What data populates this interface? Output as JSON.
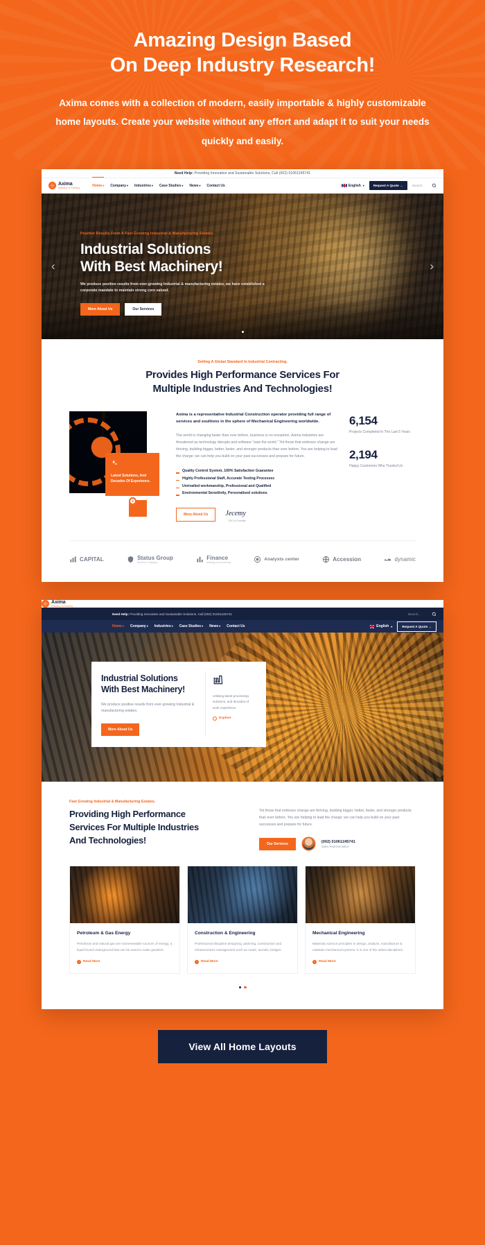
{
  "promo": {
    "title_line1": "Amazing Design Based",
    "title_line2": "On Deep Industry Research!",
    "subtitle": "Axima comes with a collection of modern, easily importable & highly customizable home layouts. Create your website without any effort and adapt it to suit your needs quickly and easily."
  },
  "colors": {
    "brand_orange": "#F4661B",
    "brand_navy": "#16213E",
    "nav2_bar": "#1E2C52",
    "muted_text": "#7B8494"
  },
  "site1": {
    "topbar": {
      "label": "Need Help:",
      "text": " Providing Innovative and Sustainable Solutions, Call (002) 01061245741"
    },
    "logo": {
      "name": "Axima",
      "tagline": "Industry & Factory"
    },
    "menu": [
      {
        "label": "Home",
        "caret": "▾",
        "active": true
      },
      {
        "label": "Company",
        "caret": "▾",
        "active": false
      },
      {
        "label": "Industries",
        "caret": "▾",
        "active": false
      },
      {
        "label": "Case Studies",
        "caret": "▾",
        "active": false
      },
      {
        "label": "News",
        "caret": "▾",
        "active": false
      },
      {
        "label": "Contact Us",
        "caret": "",
        "active": false
      }
    ],
    "lang": {
      "label": "English",
      "caret": "▾"
    },
    "quote_button": "Request A Quote →",
    "search_placeholder": "Search...",
    "hero": {
      "eyebrow": "Positive Results From A Fast Growing Industrial & Manufacturing Estates.",
      "title_line1": "Industrial Solutions",
      "title_line2": "With Best Machinery!",
      "desc": "We produce positive results from ever-growing Industrial & manufacturing estates, we have established a corporate mandate to maintain strong core valued.",
      "btn_primary": "More About Us",
      "btn_secondary": "Our Services",
      "arrow_left": "‹",
      "arrow_right": "›"
    },
    "section": {
      "eyebrow": "Setting A Global Standard In Industrial Contracting.",
      "title_line1": "Provides High Performance Services For",
      "title_line2": "Multiple Industries And Technologies!",
      "visual_box_text": "Latest Solutions, And Decades Of Experience.",
      "plus": "+",
      "lead": "Axima is a representative Industrial Construction operator providing full range of services and soultions in the sphere of Mechanical Engineering worldwide.",
      "body": "The world is changing faster than ever before, business is no exception. Axima industries are threatened as technology disrupts and software “eats the world.” Yet those that embrace change are thriving, building bigger, better, faster, and stronger products than ever before. You are helping to lead the charge; we can help you build on your past successes and prepare for future.",
      "features": [
        "Quality Control System, 100% Satisfaction Guarantee",
        "Highly Professional Staff, Accurate Testing Processes",
        "Unrivalled workmanship, Professional and Qualified",
        "Environmental Sensitivity, Personalised solutions"
      ],
      "btn": "More About Us",
      "signature": "Jecemy",
      "signature_role": "CEO & Founder",
      "stats": [
        {
          "number": "6,154",
          "label": "Projects Completed In The Last 5 Years"
        },
        {
          "number": "2,194",
          "label": "Happy Customers Who Trusted Us"
        }
      ],
      "brands": [
        {
          "name": "CAPITAL",
          "sub": ""
        },
        {
          "name": "Status Group",
          "sub": "Solution Company"
        },
        {
          "name": "Finance",
          "sub": "strategy and planning"
        },
        {
          "name": "Analysts center",
          "sub": ""
        },
        {
          "name": "Accession",
          "sub": ""
        },
        {
          "name": "dynamic",
          "sub": ""
        }
      ]
    }
  },
  "site2": {
    "topbar": {
      "label": "Need Help:",
      "text": " Providing Innovative and Sustainable Solutions, Call (002) 01061245741"
    },
    "logo": {
      "name": "Axima",
      "tagline": "Industry & Factory"
    },
    "search_placeholder": "Search...",
    "menu": [
      {
        "label": "Home",
        "caret": "▾",
        "active": true
      },
      {
        "label": "Company",
        "caret": "▾",
        "active": false
      },
      {
        "label": "Industries",
        "caret": "▾",
        "active": false
      },
      {
        "label": "Case Studies",
        "caret": "▾",
        "active": false
      },
      {
        "label": "News",
        "caret": "▾",
        "active": false
      },
      {
        "label": "Contact Us",
        "caret": "",
        "active": false
      }
    ],
    "lang": {
      "label": "English",
      "caret": "▾"
    },
    "quote_button": "Request A Quote →",
    "hero": {
      "title_line1": "Industrial Solutions",
      "title_line2": "With Best Machinery!",
      "desc": "We produce positive results from ever-growing Industrial & manufacturing estates.",
      "btn": "More About Us",
      "aside_text": "Utilising latest processing solutions, and decades of work experience",
      "explore": "Explore",
      "explore_icon": "→"
    },
    "section": {
      "eyebrow": "Fast Growing Industrial & Manufacturing Estates.",
      "title_line1": "Providing High Performance",
      "title_line2": "Services For Multiple Industries",
      "title_line3": "And Technologies!",
      "desc": "Yet those that embrace change are thriving, building bigger, better, faster, and stronger products than ever before. You are helping to lead the charge; we can help you build on your past successes and prepare for future.",
      "btn": "Our Services",
      "phone": "(002) 01061245741",
      "role": "Sales Representative",
      "cards": [
        {
          "title": "Petroleum & Gas Energy",
          "desc": "Petroleum and natural gas are nonrenewable sources of energy, a liquid found underground that can be used to make gasoline.",
          "link": "Read More"
        },
        {
          "title": "Construction & Engineering",
          "desc": "Professional discipline designing, planning, construction and infrastructures management such as roads, tunnels, bridges.",
          "link": "Read More"
        },
        {
          "title": "Mechanical Engineering",
          "desc": "Materials science principles to design, analyze, manufacture & maintain mechanical systems. It is one of the oldest disciplines.",
          "link": "Read More"
        }
      ]
    }
  },
  "bottom_cta": {
    "label": "View All Home Layouts"
  }
}
